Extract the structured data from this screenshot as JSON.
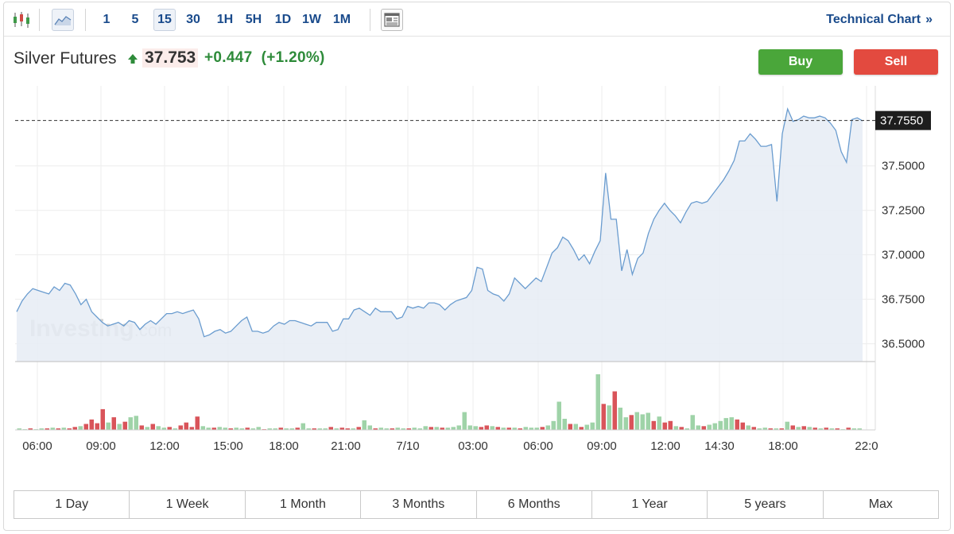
{
  "toolbar": {
    "candlestick_icon": "candlestick-chart-icon",
    "area_icon": "area-chart-icon",
    "intervals": [
      "1",
      "5",
      "15",
      "30",
      "1H",
      "5H",
      "1D",
      "1W",
      "1M"
    ],
    "active_interval": "15",
    "news_icon": "news-layout-icon",
    "technical_chart_label": "Technical Chart",
    "technical_chart_arrow": "»"
  },
  "header": {
    "title": "Silver Futures",
    "price": "37.753",
    "change": "+0.447",
    "change_pct": "(+1.20%)",
    "direction": "up",
    "buy_label": "Buy",
    "sell_label": "Sell"
  },
  "colors": {
    "line": "#6a9ccf",
    "area_fill": "#e6ecf5",
    "up": "#2e8b3a",
    "down": "#d14a44",
    "volume_up": "#9fd3a8",
    "volume_down": "#d9545a",
    "buy": "#4aa63a",
    "sell": "#e34a3f",
    "price_tag_bg": "#1e1e1e"
  },
  "watermark": {
    "brand": "Investing",
    "suffix": ".com"
  },
  "chart_data": {
    "type": "area",
    "ylim": [
      36.4,
      37.95
    ],
    "y_ticks": [
      "37.5000",
      "37.2500",
      "37.0000",
      "36.7500",
      "36.5000"
    ],
    "last_price_label": "37.7550",
    "last_price": 37.755,
    "x_tick_labels": [
      "06:00",
      "09:00",
      "12:00",
      "15:00",
      "18:00",
      "21:00",
      "7/10",
      "03:00",
      "06:00",
      "09:00",
      "12:00",
      "14:30",
      "18:00",
      "22:0"
    ],
    "values": [
      36.68,
      36.74,
      36.78,
      36.81,
      36.8,
      36.79,
      36.78,
      36.82,
      36.8,
      36.84,
      36.83,
      36.78,
      36.72,
      36.75,
      36.68,
      36.65,
      36.62,
      36.6,
      36.61,
      36.62,
      36.6,
      36.63,
      36.62,
      36.58,
      36.61,
      36.63,
      36.61,
      36.64,
      36.67,
      36.67,
      36.68,
      36.67,
      36.68,
      36.69,
      36.64,
      36.54,
      36.55,
      36.57,
      36.58,
      36.56,
      36.57,
      36.6,
      36.63,
      36.65,
      36.57,
      36.57,
      36.56,
      36.57,
      36.6,
      36.62,
      36.61,
      36.63,
      36.63,
      36.62,
      36.61,
      36.6,
      36.62,
      36.62,
      36.62,
      36.57,
      36.58,
      36.64,
      36.64,
      36.69,
      36.7,
      36.68,
      36.66,
      36.7,
      36.68,
      36.68,
      36.68,
      36.64,
      36.65,
      36.71,
      36.7,
      36.71,
      36.7,
      36.73,
      36.73,
      36.72,
      36.69,
      36.72,
      36.74,
      36.75,
      36.76,
      36.8,
      36.93,
      36.92,
      36.8,
      36.78,
      36.77,
      36.74,
      36.78,
      36.87,
      36.84,
      36.81,
      36.84,
      36.87,
      36.85,
      36.93,
      37.01,
      37.04,
      37.1,
      37.08,
      37.03,
      36.97,
      37.0,
      36.95,
      37.02,
      37.08,
      37.46,
      37.2,
      37.2,
      36.91,
      37.03,
      36.89,
      36.98,
      37.01,
      37.12,
      37.2,
      37.25,
      37.29,
      37.25,
      37.22,
      37.18,
      37.24,
      37.29,
      37.3,
      37.29,
      37.3,
      37.34,
      37.38,
      37.42,
      37.47,
      37.53,
      37.64,
      37.64,
      37.68,
      37.65,
      37.61,
      37.61,
      37.62,
      37.3,
      37.68,
      37.82,
      37.75,
      37.76,
      37.78,
      37.77,
      37.77,
      37.78,
      37.77,
      37.74,
      37.7,
      37.58,
      37.52,
      37.76,
      37.77,
      37.753
    ],
    "volume": [
      {
        "v": 2,
        "up": true
      },
      {
        "v": 1,
        "up": true
      },
      {
        "v": 2,
        "up": false
      },
      {
        "v": 1,
        "up": true
      },
      {
        "v": 2,
        "up": true
      },
      {
        "v": 2,
        "up": false
      },
      {
        "v": 3,
        "up": true
      },
      {
        "v": 2,
        "up": false
      },
      {
        "v": 3,
        "up": true
      },
      {
        "v": 2,
        "up": false
      },
      {
        "v": 4,
        "up": false
      },
      {
        "v": 5,
        "up": true
      },
      {
        "v": 8,
        "up": false
      },
      {
        "v": 14,
        "up": false
      },
      {
        "v": 9,
        "up": false
      },
      {
        "v": 28,
        "up": false
      },
      {
        "v": 10,
        "up": true
      },
      {
        "v": 17,
        "up": false
      },
      {
        "v": 8,
        "up": true
      },
      {
        "v": 11,
        "up": false
      },
      {
        "v": 17,
        "up": true
      },
      {
        "v": 19,
        "up": true
      },
      {
        "v": 6,
        "up": false
      },
      {
        "v": 4,
        "up": true
      },
      {
        "v": 8,
        "up": false
      },
      {
        "v": 5,
        "up": true
      },
      {
        "v": 3,
        "up": true
      },
      {
        "v": 4,
        "up": false
      },
      {
        "v": 2,
        "up": true
      },
      {
        "v": 6,
        "up": false
      },
      {
        "v": 10,
        "up": false
      },
      {
        "v": 4,
        "up": false
      },
      {
        "v": 18,
        "up": false
      },
      {
        "v": 5,
        "up": true
      },
      {
        "v": 3,
        "up": true
      },
      {
        "v": 3,
        "up": false
      },
      {
        "v": 4,
        "up": true
      },
      {
        "v": 3,
        "up": true
      },
      {
        "v": 2,
        "up": false
      },
      {
        "v": 3,
        "up": true
      },
      {
        "v": 2,
        "up": true
      },
      {
        "v": 3,
        "up": false
      },
      {
        "v": 2,
        "up": true
      },
      {
        "v": 4,
        "up": true
      },
      {
        "v": 1,
        "up": false
      },
      {
        "v": 2,
        "up": true
      },
      {
        "v": 2,
        "up": true
      },
      {
        "v": 3,
        "up": false
      },
      {
        "v": 2,
        "up": true
      },
      {
        "v": 2,
        "up": true
      },
      {
        "v": 3,
        "up": false
      },
      {
        "v": 9,
        "up": true
      },
      {
        "v": 2,
        "up": true
      },
      {
        "v": 2,
        "up": false
      },
      {
        "v": 2,
        "up": true
      },
      {
        "v": 2,
        "up": true
      },
      {
        "v": 4,
        "up": false
      },
      {
        "v": 2,
        "up": true
      },
      {
        "v": 3,
        "up": false
      },
      {
        "v": 2,
        "up": false
      },
      {
        "v": 2,
        "up": true
      },
      {
        "v": 4,
        "up": false
      },
      {
        "v": 13,
        "up": true
      },
      {
        "v": 6,
        "up": true
      },
      {
        "v": 2,
        "up": false
      },
      {
        "v": 3,
        "up": true
      },
      {
        "v": 2,
        "up": true
      },
      {
        "v": 2,
        "up": false
      },
      {
        "v": 3,
        "up": true
      },
      {
        "v": 2,
        "up": true
      },
      {
        "v": 2,
        "up": false
      },
      {
        "v": 3,
        "up": true
      },
      {
        "v": 2,
        "up": true
      },
      {
        "v": 5,
        "up": true
      },
      {
        "v": 4,
        "up": false
      },
      {
        "v": 4,
        "up": true
      },
      {
        "v": 3,
        "up": false
      },
      {
        "v": 3,
        "up": true
      },
      {
        "v": 4,
        "up": true
      },
      {
        "v": 6,
        "up": true
      },
      {
        "v": 24,
        "up": true
      },
      {
        "v": 6,
        "up": true
      },
      {
        "v": 5,
        "up": true
      },
      {
        "v": 4,
        "up": false
      },
      {
        "v": 6,
        "up": false
      },
      {
        "v": 5,
        "up": true
      },
      {
        "v": 4,
        "up": false
      },
      {
        "v": 3,
        "up": true
      },
      {
        "v": 3,
        "up": false
      },
      {
        "v": 3,
        "up": true
      },
      {
        "v": 2,
        "up": false
      },
      {
        "v": 4,
        "up": true
      },
      {
        "v": 3,
        "up": true
      },
      {
        "v": 3,
        "up": true
      },
      {
        "v": 4,
        "up": false
      },
      {
        "v": 6,
        "up": true
      },
      {
        "v": 12,
        "up": true
      },
      {
        "v": 38,
        "up": true
      },
      {
        "v": 15,
        "up": true
      },
      {
        "v": 8,
        "up": false
      },
      {
        "v": 8,
        "up": true
      },
      {
        "v": 4,
        "up": false
      },
      {
        "v": 7,
        "up": true
      },
      {
        "v": 10,
        "up": true
      },
      {
        "v": 75,
        "up": true
      },
      {
        "v": 35,
        "up": false
      },
      {
        "v": 33,
        "up": true
      },
      {
        "v": 52,
        "up": false
      },
      {
        "v": 30,
        "up": true
      },
      {
        "v": 17,
        "up": true
      },
      {
        "v": 20,
        "up": false
      },
      {
        "v": 24,
        "up": true
      },
      {
        "v": 21,
        "up": true
      },
      {
        "v": 23,
        "up": true
      },
      {
        "v": 12,
        "up": false
      },
      {
        "v": 18,
        "up": true
      },
      {
        "v": 10,
        "up": false
      },
      {
        "v": 12,
        "up": false
      },
      {
        "v": 5,
        "up": true
      },
      {
        "v": 4,
        "up": false
      },
      {
        "v": 2,
        "up": true
      },
      {
        "v": 20,
        "up": true
      },
      {
        "v": 6,
        "up": true
      },
      {
        "v": 5,
        "up": false
      },
      {
        "v": 7,
        "up": true
      },
      {
        "v": 9,
        "up": true
      },
      {
        "v": 12,
        "up": true
      },
      {
        "v": 16,
        "up": true
      },
      {
        "v": 17,
        "up": true
      },
      {
        "v": 14,
        "up": false
      },
      {
        "v": 10,
        "up": false
      },
      {
        "v": 6,
        "up": true
      },
      {
        "v": 4,
        "up": false
      },
      {
        "v": 2,
        "up": true
      },
      {
        "v": 3,
        "up": true
      },
      {
        "v": 2,
        "up": false
      },
      {
        "v": 2,
        "up": true
      },
      {
        "v": 2,
        "up": false
      },
      {
        "v": 11,
        "up": true
      },
      {
        "v": 6,
        "up": false
      },
      {
        "v": 4,
        "up": true
      },
      {
        "v": 5,
        "up": false
      },
      {
        "v": 4,
        "up": true
      },
      {
        "v": 3,
        "up": false
      },
      {
        "v": 2,
        "up": true
      },
      {
        "v": 3,
        "up": false
      },
      {
        "v": 2,
        "up": true
      },
      {
        "v": 2,
        "up": false
      },
      {
        "v": 1,
        "up": true
      },
      {
        "v": 3,
        "up": false
      },
      {
        "v": 2,
        "up": true
      },
      {
        "v": 2,
        "up": true
      }
    ]
  },
  "ranges": [
    "1 Day",
    "1 Week",
    "1 Month",
    "3 Months",
    "6 Months",
    "1 Year",
    "5 years",
    "Max"
  ]
}
